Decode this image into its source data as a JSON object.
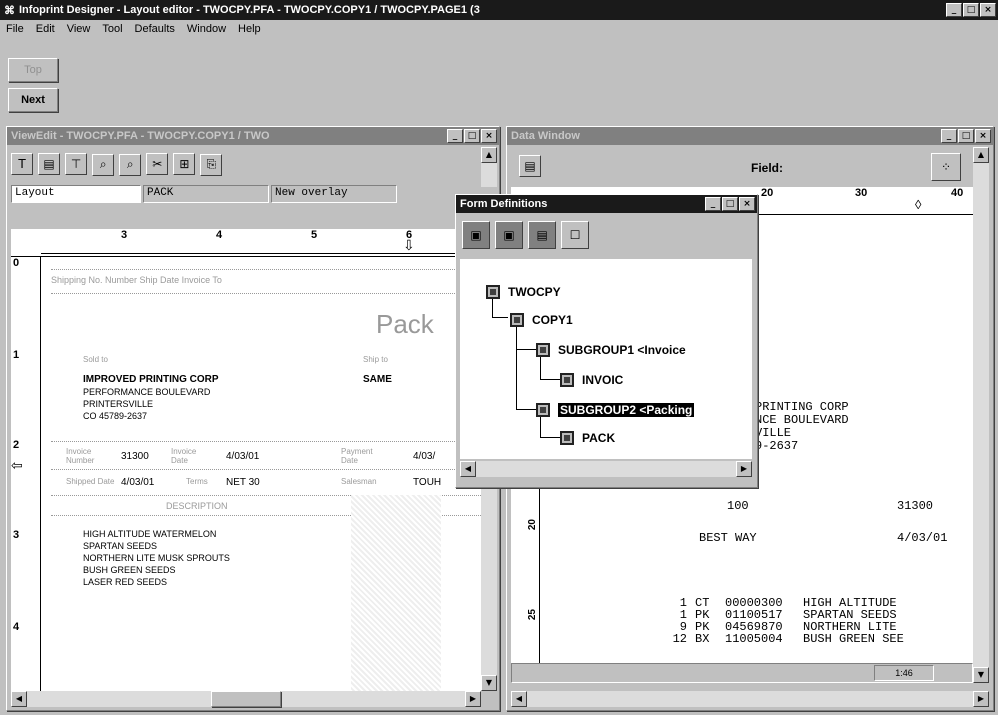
{
  "app": {
    "title": "Infoprint Designer - Layout editor - TWOCPY.PFA - TWOCPY.COPY1 / TWOCPY.PAGE1 (3",
    "menu": [
      "File",
      "Edit",
      "View",
      "Tool",
      "Defaults",
      "Window",
      "Help"
    ],
    "toolbar": {
      "top_label": "Top",
      "next_label": "Next"
    }
  },
  "left_window": {
    "title": "ViewEdit - TWOCPY.PFA - TWOCPY.COPY1 / TWO",
    "fields": {
      "layout": "Layout",
      "pack": "PACK",
      "overlay": "New overlay"
    },
    "ruler_labels": [
      "3",
      "4",
      "5",
      "6"
    ],
    "vruler_labels": [
      "0",
      "1",
      "2",
      "3",
      "4"
    ],
    "header_row": "Shipping No. Number    Ship Date    Invoice    To",
    "form_title": "Pack",
    "address_label": "Sold to",
    "ship_to_label": "Ship to",
    "address_lines": [
      "IMPROVED PRINTING CORP",
      "PERFORMANCE BOULEVARD",
      "PRINTERSVILLE",
      "CO 45789-2637"
    ],
    "ship_to_value": "SAME",
    "row1": [
      "Invoice Number",
      "31300",
      "Invoice Date",
      "4/03/01",
      "Payment Date",
      "4/03/"
    ],
    "row2": [
      "Shipped Date",
      "4/03/01",
      "Terms",
      "NET 30",
      "Salesman",
      "TOUH"
    ],
    "desc_header": "DESCRIPTION",
    "desc_lines": [
      "HIGH ALTITUDE WATERMELON",
      "SPARTAN SEEDS",
      "NORTHERN LITE MUSK SPROUTS",
      "BUSH GREEN SEEDS",
      "LASER RED SEEDS"
    ]
  },
  "form_defs": {
    "title": "Form Definitions",
    "tree": [
      "TWOCPY",
      "COPY1",
      "SUBGROUP1 <Invoice",
      "INVOIC",
      "SUBGROUP2 <Packing",
      "PACK"
    ]
  },
  "data_window": {
    "title": "Data Window",
    "field_label": "Field:",
    "ruler_labels": [
      "20",
      "30",
      "40"
    ],
    "lines": [
      " PRINTING CORP",
      "NCE BOULEVARD",
      "VILLE",
      "9-2637"
    ],
    "row_a": [
      "100",
      "31300"
    ],
    "row_b": [
      "BEST WAY",
      "4/03/01"
    ],
    "vlabels": [
      "20",
      "25"
    ],
    "items": [
      {
        "qty": "1",
        "unit": "CT",
        "code": "00000300",
        "desc": "HIGH ALTITUDE"
      },
      {
        "qty": "1",
        "unit": "PK",
        "code": "01100517",
        "desc": "SPARTAN SEEDS"
      },
      {
        "qty": "9",
        "unit": "PK",
        "code": "04569870",
        "desc": "NORTHERN LITE"
      },
      {
        "qty": "12",
        "unit": "BX",
        "code": "11005004",
        "desc": "BUSH GREEN SEE"
      }
    ],
    "status": "1:46"
  }
}
